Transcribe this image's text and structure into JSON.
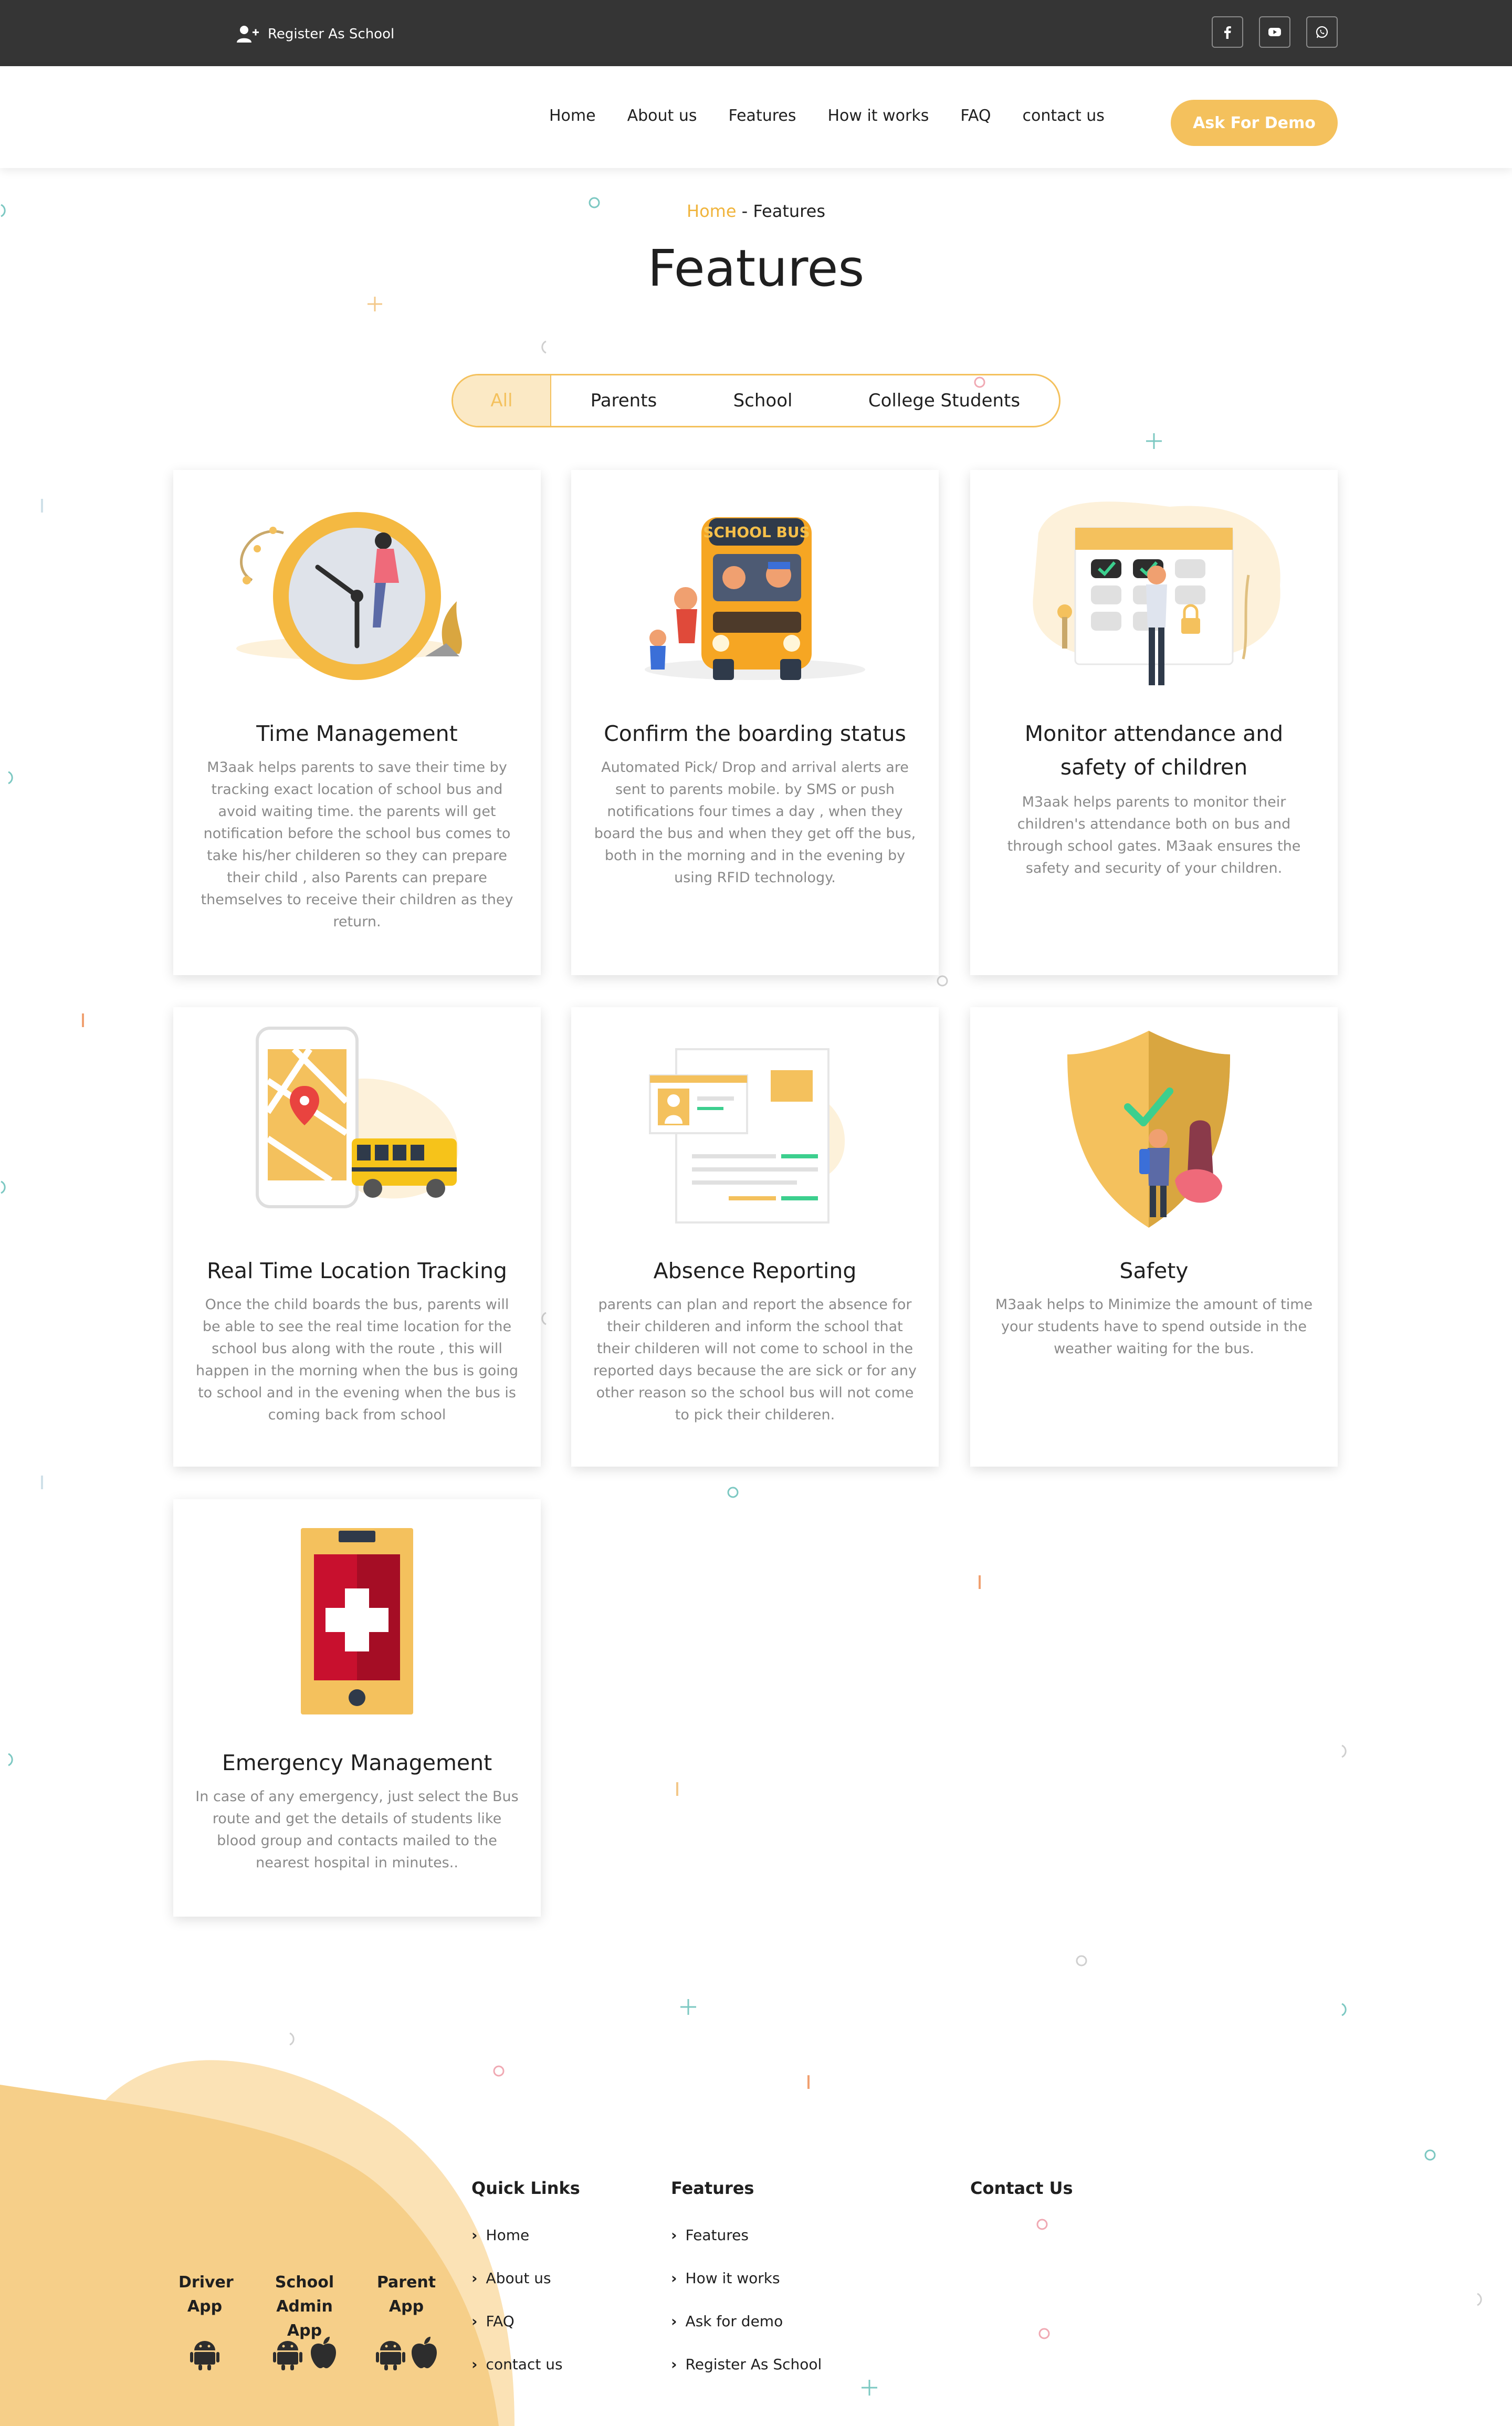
{
  "topbar": {
    "register_label": "Register As School",
    "socials": [
      "facebook-icon",
      "youtube-icon",
      "whatsapp-icon"
    ]
  },
  "nav": {
    "links": [
      "Home",
      "About us",
      "Features",
      "How it works",
      "FAQ",
      "contact us"
    ],
    "demo_button": "Ask For Demo"
  },
  "breadcrumb": {
    "home": "Home",
    "separator": " - ",
    "current": "Features"
  },
  "page_title": "Features",
  "tabs": [
    "All",
    "Parents",
    "School",
    "College Students"
  ],
  "cards": [
    {
      "title": "Time Management",
      "text": "M3aak helps parents to save their time by tracking exact location of school bus and avoid waiting time. the parents will get notification before the school bus comes to take his/her childeren so they can prepare their child , also Parents can prepare themselves to receive their children as they return."
    },
    {
      "title": "Confirm the boarding status",
      "text": "Automated Pick/ Drop and arrival alerts are sent to parents mobile. by SMS or push notifications four times a day , when they board the bus and when they get off the bus, both in the morning and in the evening by using RFID technology.",
      "bus_sign": "SCHOOL BUS"
    },
    {
      "title": "Monitor attendance and safety of children",
      "text": "M3aak helps parents to monitor their children's attendance both on bus and through school gates. M3aak ensures the safety and security of your children."
    },
    {
      "title": "Real Time Location Tracking",
      "text": "Once the child boards the bus, parents will be able to see the real time location for the school bus along with the route , this will happen in the morning when the bus is going to school and in the evening when the bus is coming back from school"
    },
    {
      "title": "Absence Reporting",
      "text": "parents can plan and report the absence for their childeren and inform the school that their childeren will not come to school in the reported days because the are sick or for any other reason so the school bus will not come to pick their childeren."
    },
    {
      "title": "Safety",
      "text": "M3aak helps to Minimize the amount of time your students have to spend outside in the weather waiting for the bus."
    },
    {
      "title": "Emergency Management",
      "text": "In case of any emergency, just select the Bus route and get the details of students like blood group and contacts mailed to the nearest hospital in minutes.."
    }
  ],
  "footer": {
    "apps": [
      {
        "line1": "Driver",
        "line2": "App"
      },
      {
        "line1": "School Admin",
        "line2": "App"
      },
      {
        "line1": "Parent",
        "line2": "App"
      }
    ],
    "quick_links_title": "Quick Links",
    "quick_links": [
      "Home",
      "About us",
      "FAQ",
      "contact us"
    ],
    "features_title": "Features",
    "features_links": [
      "Features",
      "How it works",
      "Ask for demo",
      "Register As School"
    ],
    "contact_title": "Contact Us"
  },
  "colors": {
    "accent": "#f4c15d",
    "topbar": "#353535",
    "text": "#1f1f1f",
    "muted": "#8a8a8a"
  }
}
